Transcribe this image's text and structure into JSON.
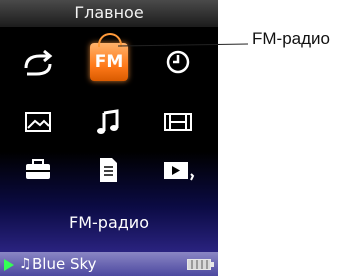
{
  "titlebar": {
    "title": "Главное"
  },
  "menu": {
    "selected": "FM-радио",
    "fm_badge": "FM",
    "icons": [
      "repeat-icon",
      "fm-radio-icon",
      "clock-icon",
      "photo-icon",
      "music-note-icon",
      "video-film-icon",
      "settings-toolbox-icon",
      "document-icon",
      "slideshow-icon"
    ]
  },
  "statusbar": {
    "state_icon": "play-icon",
    "note_glyph": "♫",
    "track_title": "Blue Sky",
    "battery_icon": "battery-icon"
  },
  "callout": {
    "text": "FM-радио"
  },
  "colors": {
    "accent": "#ff7a1a",
    "background": "#000000",
    "status_bar": "#4c48a0",
    "play": "#33ff55"
  }
}
